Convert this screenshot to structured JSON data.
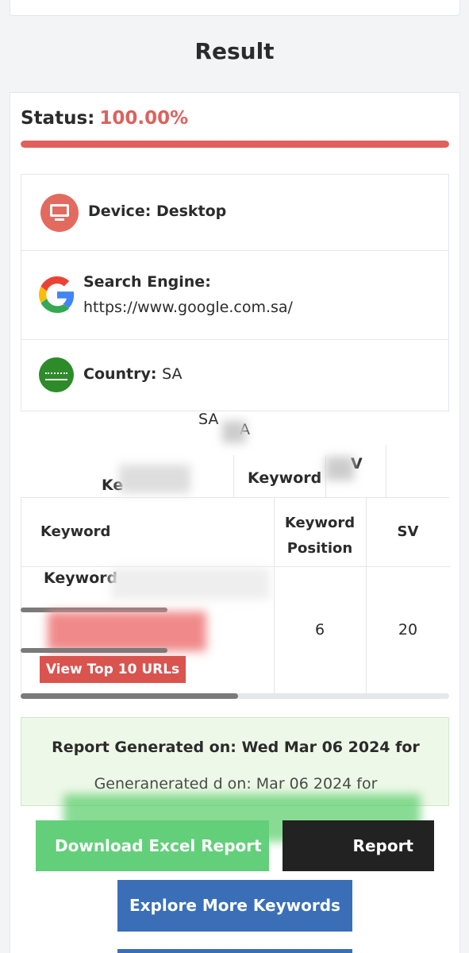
{
  "page": {
    "title": "Result"
  },
  "status": {
    "label": "Status:",
    "value": "100.00%",
    "progress_percent": 100,
    "accent": "#dc625e"
  },
  "info": {
    "device": {
      "label": "Device:",
      "value": "Desktop",
      "icon": "desktop-monitor-icon"
    },
    "search_engine": {
      "label": "Search Engine:",
      "value": "https://www.google.com.sa/",
      "icon": "google-icon"
    },
    "country": {
      "label": "Country:",
      "value": "SA",
      "icon": "saudi-flag-icon"
    }
  },
  "ghost_text": {
    "sa": "SA",
    "a": "A",
    "keyword": "Keyword",
    "ke": "Ke",
    "v": "V"
  },
  "table": {
    "headers": {
      "keyword": "Keyword",
      "position": "Keyword Position",
      "sv": "SV"
    },
    "rows": [
      {
        "keyword": "Keyword",
        "position": "6",
        "sv": "20"
      }
    ],
    "view_button": "View Top 10 URLs"
  },
  "report": {
    "line1": "Report Generated on: Wed Mar 06 2024 for",
    "line2": "Generanerated d on: Mar 06 2024 for"
  },
  "buttons": {
    "download_excel": "Download Excel Report",
    "download_pdf": "Report",
    "explore": "Explore More Keywords"
  },
  "colors": {
    "excel": "#63cf7a",
    "pdf": "#222222",
    "explore": "#3a6fb8",
    "report_bg": "#eef8e8"
  }
}
